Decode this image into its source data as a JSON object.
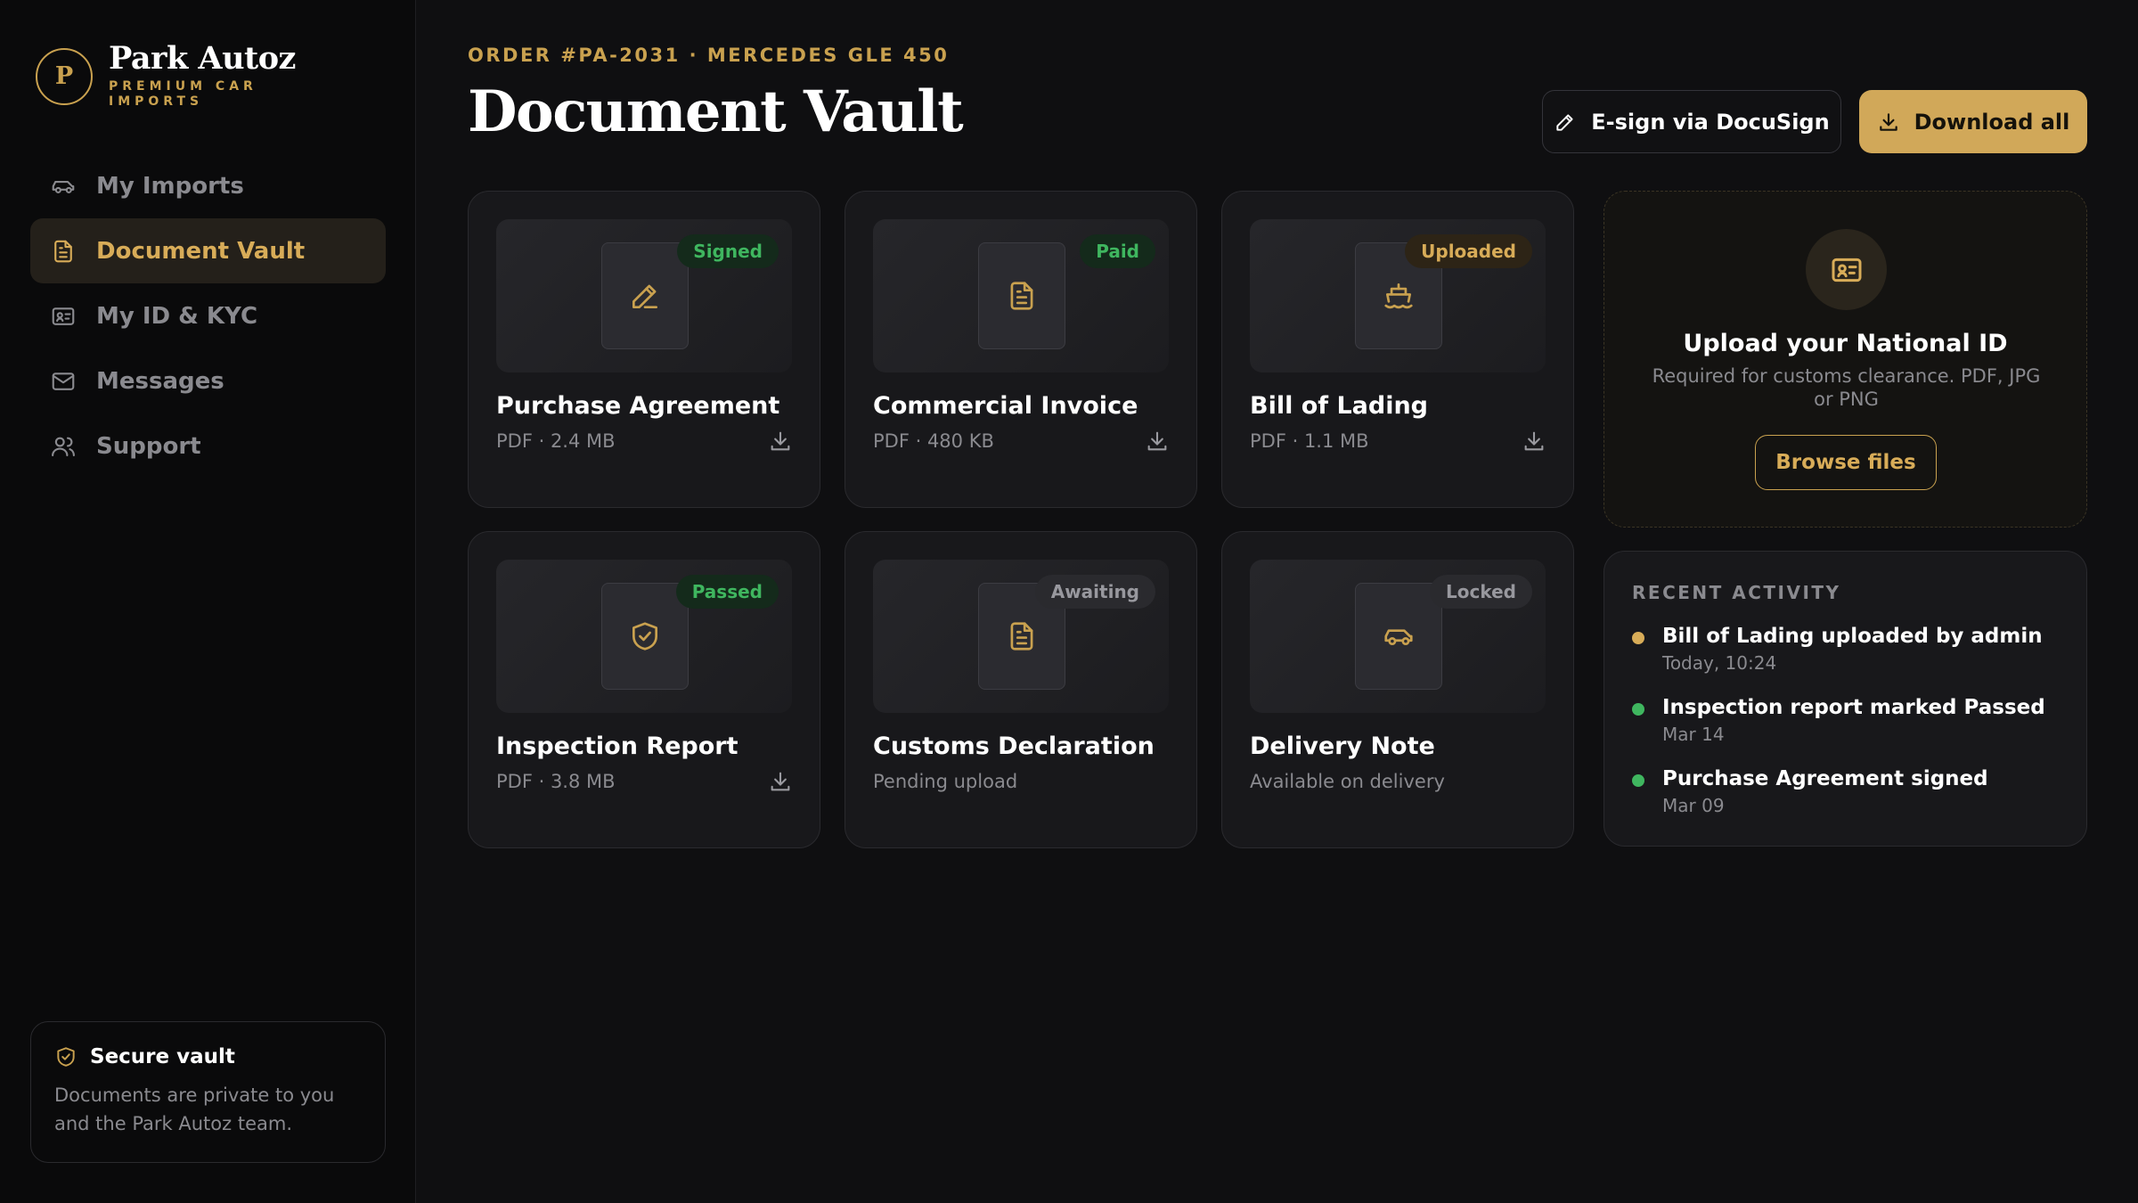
{
  "brand": {
    "mark": "P",
    "name": "Park Autoz",
    "tagline": "PREMIUM CAR IMPORTS"
  },
  "nav": {
    "items": [
      {
        "label": "My Imports",
        "icon": "car-icon",
        "active": false
      },
      {
        "label": "Document Vault",
        "icon": "document-icon",
        "active": true
      },
      {
        "label": "My ID & KYC",
        "icon": "id-card-icon",
        "active": false
      },
      {
        "label": "Messages",
        "icon": "mail-icon",
        "active": false
      },
      {
        "label": "Support",
        "icon": "users-icon",
        "active": false
      }
    ]
  },
  "secure": {
    "title": "Secure vault",
    "text": "Documents are private to you and the Park Autoz team."
  },
  "header": {
    "order": "ORDER #PA-2031 · MERCEDES GLE 450",
    "title": "Document Vault",
    "esign_label": "E-sign via DocuSign",
    "download_label": "Download all"
  },
  "documents": [
    {
      "title": "Purchase Agreement",
      "meta": "PDF · 2.4 MB",
      "status": "Signed",
      "status_color": "#3fb65f",
      "icon": "pen-icon",
      "downloadable": true
    },
    {
      "title": "Commercial Invoice",
      "meta": "PDF · 480 KB",
      "status": "Paid",
      "status_color": "#3fb65f",
      "icon": "file-text-icon",
      "downloadable": true
    },
    {
      "title": "Bill of Lading",
      "meta": "PDF · 1.1 MB",
      "status": "Uploaded",
      "status_color": "#d8ac58",
      "icon": "ship-icon",
      "downloadable": true
    },
    {
      "title": "Inspection Report",
      "meta": "PDF · 3.8 MB",
      "status": "Passed",
      "status_color": "#3fb65f",
      "icon": "shield-check-icon",
      "downloadable": true
    },
    {
      "title": "Customs Declaration",
      "meta": "Pending upload",
      "status": "Awaiting",
      "status_color": "#98989e",
      "icon": "file-text-icon",
      "downloadable": false
    },
    {
      "title": "Delivery Note",
      "meta": "Available on delivery",
      "status": "Locked",
      "status_color": "#98989e",
      "icon": "car-icon",
      "downloadable": false
    }
  ],
  "upload": {
    "title": "Upload your National ID",
    "description": "Required for customs clearance. PDF, JPG or PNG",
    "button": "Browse files"
  },
  "activity": {
    "heading": "RECENT ACTIVITY",
    "items": [
      {
        "title": "Bill of Lading uploaded by admin",
        "time": "Today, 10:24",
        "dot_color": "#d8ac58"
      },
      {
        "title": "Inspection report marked Passed",
        "time": "Mar 14",
        "dot_color": "#3fb65f"
      },
      {
        "title": "Purchase Agreement signed",
        "time": "Mar 09",
        "dot_color": "#3fb65f"
      }
    ]
  },
  "colors": {
    "accent": "#d1a859",
    "background": "#0f0f11",
    "card": "#18181b",
    "success": "#3fb65f"
  }
}
